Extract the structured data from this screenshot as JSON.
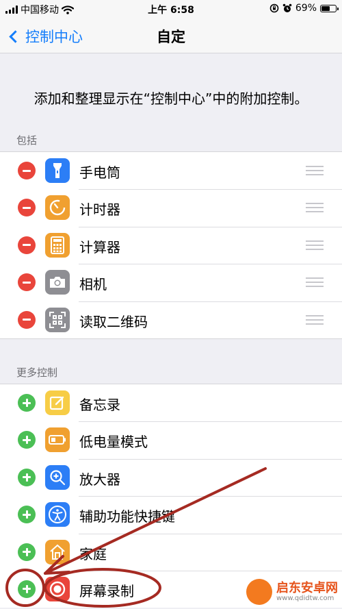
{
  "status_bar": {
    "carrier": "中国移动",
    "time": "上午 6:58",
    "battery_percent": "69%",
    "battery_level": 0.69,
    "icons": [
      "signal-icon",
      "wifi-icon",
      "rotation-lock-icon",
      "alarm-icon",
      "battery-icon"
    ]
  },
  "nav": {
    "back_label": "控制中心",
    "title": "自定"
  },
  "description": "添加和整理显示在“控制中心”中的附加控制。",
  "included": {
    "header": "包括",
    "items": [
      {
        "label": "手电筒",
        "icon": "flashlight-icon",
        "color": "#2c7ef6"
      },
      {
        "label": "计时器",
        "icon": "timer-icon",
        "color": "#f0a030"
      },
      {
        "label": "计算器",
        "icon": "calculator-icon",
        "color": "#f0a030"
      },
      {
        "label": "相机",
        "icon": "camera-icon",
        "color": "#8e8e93"
      },
      {
        "label": "读取二维码",
        "icon": "qr-code-icon",
        "color": "#8e8e93"
      }
    ]
  },
  "more": {
    "header": "更多控制",
    "items": [
      {
        "label": "备忘录",
        "icon": "notes-icon",
        "color": "#f7cd46"
      },
      {
        "label": "低电量模式",
        "icon": "low-power-icon",
        "color": "#f0a030"
      },
      {
        "label": "放大器",
        "icon": "magnifier-icon",
        "color": "#2c7ef6"
      },
      {
        "label": "辅助功能快捷键",
        "icon": "accessibility-icon",
        "color": "#2c7ef6"
      },
      {
        "label": "家庭",
        "icon": "home-icon",
        "color": "#f0a030"
      },
      {
        "label": "屏幕录制",
        "icon": "screen-record-icon",
        "color": "#e9453b"
      }
    ]
  },
  "annotation_color": "#a52a22",
  "watermark": {
    "title": "启东安卓网",
    "url": "www.qdidtw.com"
  }
}
